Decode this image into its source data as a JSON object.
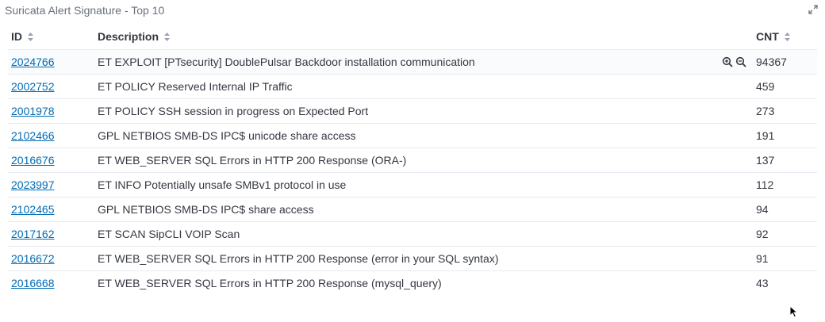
{
  "panel": {
    "title": "Suricata Alert Signature - Top 10"
  },
  "table": {
    "headers": {
      "id": "ID",
      "description": "Description",
      "count": "CNT"
    },
    "rows": [
      {
        "id": "2024766",
        "description": "ET EXPLOIT [PTsecurity] DoublePulsar Backdoor installation communication",
        "count": "94367"
      },
      {
        "id": "2002752",
        "description": "ET POLICY Reserved Internal IP Traffic",
        "count": "459"
      },
      {
        "id": "2001978",
        "description": "ET POLICY SSH session in progress on Expected Port",
        "count": "273"
      },
      {
        "id": "2102466",
        "description": "GPL NETBIOS SMB-DS IPC$ unicode share access",
        "count": "191"
      },
      {
        "id": "2016676",
        "description": "ET WEB_SERVER SQL Errors in HTTP 200 Response (ORA-)",
        "count": "137"
      },
      {
        "id": "2023997",
        "description": "ET INFO Potentially unsafe SMBv1 protocol in use",
        "count": "112"
      },
      {
        "id": "2102465",
        "description": "GPL NETBIOS SMB-DS IPC$ share access",
        "count": "94"
      },
      {
        "id": "2017162",
        "description": "ET SCAN SipCLI VOIP Scan",
        "count": "92"
      },
      {
        "id": "2016672",
        "description": "ET WEB_SERVER SQL Errors in HTTP 200 Response (error in your SQL syntax)",
        "count": "91"
      },
      {
        "id": "2016668",
        "description": "ET WEB_SERVER SQL Errors in HTTP 200 Response (mysql_query)",
        "count": "43"
      }
    ]
  },
  "colors": {
    "link": "#006bb4",
    "text": "#343741",
    "muted": "#69707d",
    "border": "#e6e9ef"
  }
}
